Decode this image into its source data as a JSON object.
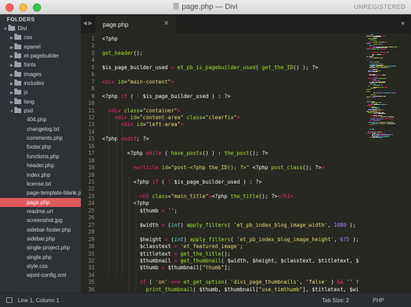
{
  "window": {
    "title": "page.php — Divi",
    "license": "UNREGISTERED"
  },
  "sidebar": {
    "header": "FOLDERS",
    "items": [
      {
        "label": "Divi",
        "type": "folder",
        "depth": 0,
        "open": true
      },
      {
        "label": "css",
        "type": "folder",
        "depth": 1,
        "open": false
      },
      {
        "label": "epanel",
        "type": "folder",
        "depth": 1,
        "open": false
      },
      {
        "label": "et-pagebuilder",
        "type": "folder",
        "depth": 1,
        "open": false
      },
      {
        "label": "fonts",
        "type": "folder",
        "depth": 1,
        "open": false
      },
      {
        "label": "images",
        "type": "folder",
        "depth": 1,
        "open": false
      },
      {
        "label": "includes",
        "type": "folder",
        "depth": 1,
        "open": false
      },
      {
        "label": "js",
        "type": "folder",
        "depth": 1,
        "open": false
      },
      {
        "label": "lang",
        "type": "folder",
        "depth": 1,
        "open": false
      },
      {
        "label": "psd",
        "type": "folder",
        "depth": 1,
        "open": true
      },
      {
        "label": "404.php",
        "type": "file",
        "depth": 2
      },
      {
        "label": "changelog.txt",
        "type": "file",
        "depth": 2
      },
      {
        "label": "comments.php",
        "type": "file",
        "depth": 2
      },
      {
        "label": "footer.php",
        "type": "file",
        "depth": 2
      },
      {
        "label": "functions.php",
        "type": "file",
        "depth": 2
      },
      {
        "label": "header.php",
        "type": "file",
        "depth": 2
      },
      {
        "label": "index.php",
        "type": "file",
        "depth": 2
      },
      {
        "label": "license.txt",
        "type": "file",
        "depth": 2
      },
      {
        "label": "page-template-blank.php",
        "type": "file",
        "depth": 2
      },
      {
        "label": "page.php",
        "type": "file",
        "depth": 2,
        "selected": true
      },
      {
        "label": "readme.url",
        "type": "file",
        "depth": 2
      },
      {
        "label": "screenshot.jpg",
        "type": "file",
        "depth": 2
      },
      {
        "label": "sidebar-footer.php",
        "type": "file",
        "depth": 2
      },
      {
        "label": "sidebar.php",
        "type": "file",
        "depth": 2
      },
      {
        "label": "single-project.php",
        "type": "file",
        "depth": 2
      },
      {
        "label": "single.php",
        "type": "file",
        "depth": 2
      },
      {
        "label": "style.css",
        "type": "file",
        "depth": 2
      },
      {
        "label": "wpml-config.xml",
        "type": "file",
        "depth": 2
      }
    ]
  },
  "tabbar": {
    "prev_icon": "◀",
    "next_icon": "▶",
    "active_tab": "page.php",
    "close_icon": "✕",
    "dropdown_icon": "▼"
  },
  "editor": {
    "lines": [
      {
        "n": "1",
        "segs": [
          [
            "php",
            "<?php"
          ]
        ]
      },
      {
        "n": "2",
        "segs": []
      },
      {
        "n": "3",
        "segs": [
          [
            "fn",
            "get_header"
          ],
          [
            "punc",
            "();"
          ]
        ]
      },
      {
        "n": "4",
        "segs": []
      },
      {
        "n": "5",
        "segs": [
          [
            "var",
            "$is_page_builder_used "
          ],
          [
            "kw",
            "="
          ],
          [
            "var",
            " "
          ],
          [
            "fn",
            "et_pb_is_pagebuilder_used"
          ],
          [
            "punc",
            "( "
          ],
          [
            "fn",
            "get_the_ID"
          ],
          [
            "punc",
            "() ); ?>"
          ]
        ]
      },
      {
        "n": "6",
        "segs": []
      },
      {
        "n": "7",
        "segs": [
          [
            "tag",
            "<div "
          ],
          [
            "attr",
            "id"
          ],
          [
            "punc",
            "="
          ],
          [
            "str",
            "\"main-content\""
          ],
          [
            "tag",
            ">"
          ]
        ]
      },
      {
        "n": "8",
        "segs": []
      },
      {
        "n": "9",
        "segs": [
          [
            "php",
            "<?php "
          ],
          [
            "kw",
            "if"
          ],
          [
            "punc",
            " ( "
          ],
          [
            "kw",
            "!"
          ],
          [
            "punc",
            " $is_page_builder_used ) : ?>"
          ]
        ]
      },
      {
        "n": "10",
        "segs": []
      },
      {
        "n": "11",
        "segs": [
          [
            "var",
            "  "
          ],
          [
            "tag",
            "<div "
          ],
          [
            "attr",
            "class"
          ],
          [
            "punc",
            "="
          ],
          [
            "str",
            "\"container\""
          ],
          [
            "tag",
            ">"
          ]
        ]
      },
      {
        "n": "12",
        "segs": [
          [
            "var",
            "    "
          ],
          [
            "tag",
            "<div "
          ],
          [
            "attr",
            "id"
          ],
          [
            "punc",
            "="
          ],
          [
            "str",
            "\"content-area\""
          ],
          [
            "var",
            " "
          ],
          [
            "attr",
            "class"
          ],
          [
            "punc",
            "="
          ],
          [
            "str",
            "\"clearfix\""
          ],
          [
            "tag",
            ">"
          ]
        ]
      },
      {
        "n": "13",
        "segs": [
          [
            "var",
            "      "
          ],
          [
            "tag",
            "<div "
          ],
          [
            "attr",
            "id"
          ],
          [
            "punc",
            "="
          ],
          [
            "str",
            "\"left-area\""
          ],
          [
            "tag",
            ">"
          ]
        ]
      },
      {
        "n": "14",
        "segs": []
      },
      {
        "n": "15",
        "segs": [
          [
            "php",
            "<?php "
          ],
          [
            "kw",
            "endif"
          ],
          [
            "punc",
            "; ?>"
          ]
        ]
      },
      {
        "n": "16",
        "segs": []
      },
      {
        "n": "17",
        "segs": [
          [
            "var",
            "        "
          ],
          [
            "php",
            "<?php "
          ],
          [
            "kw",
            "while"
          ],
          [
            "punc",
            " ( "
          ],
          [
            "fn",
            "have_posts"
          ],
          [
            "punc",
            "() ) : "
          ],
          [
            "fn",
            "the_post"
          ],
          [
            "punc",
            "(); ?>"
          ]
        ]
      },
      {
        "n": "18",
        "segs": []
      },
      {
        "n": "19",
        "segs": [
          [
            "var",
            "          "
          ],
          [
            "tag",
            "<article "
          ],
          [
            "attr",
            "id"
          ],
          [
            "punc",
            "="
          ],
          [
            "str",
            "\"post-<?php the_ID(); ?>\""
          ],
          [
            "var",
            " "
          ],
          [
            "php",
            "<?php "
          ],
          [
            "fn",
            "post_class"
          ],
          [
            "punc",
            "(); ?>"
          ],
          [
            "tag",
            ">"
          ]
        ]
      },
      {
        "n": "20",
        "segs": []
      },
      {
        "n": "21",
        "segs": [
          [
            "var",
            "          "
          ],
          [
            "php",
            "<?php "
          ],
          [
            "kw",
            "if"
          ],
          [
            "punc",
            " ( "
          ],
          [
            "kw",
            "!"
          ],
          [
            "punc",
            " $is_page_builder_used ) : ?>"
          ]
        ]
      },
      {
        "n": "22",
        "segs": []
      },
      {
        "n": "23",
        "segs": [
          [
            "var",
            "            "
          ],
          [
            "tag",
            "<h1 "
          ],
          [
            "attr",
            "class"
          ],
          [
            "punc",
            "="
          ],
          [
            "str",
            "\"main_title\""
          ],
          [
            "tag",
            ">"
          ],
          [
            "php",
            "<?php "
          ],
          [
            "fn",
            "the_title"
          ],
          [
            "punc",
            "(); ?>"
          ],
          [
            "tag",
            "</h1>"
          ]
        ]
      },
      {
        "n": "24",
        "segs": [
          [
            "var",
            "          "
          ],
          [
            "php",
            "<?php"
          ]
        ]
      },
      {
        "n": "25",
        "segs": [
          [
            "var",
            "            $thumb "
          ],
          [
            "kw",
            "="
          ],
          [
            "var",
            " "
          ],
          [
            "str",
            "''"
          ],
          [
            "punc",
            ";"
          ]
        ]
      },
      {
        "n": "26",
        "segs": []
      },
      {
        "n": "27",
        "segs": [
          [
            "var",
            "            $width "
          ],
          [
            "kw",
            "="
          ],
          [
            "var",
            " "
          ],
          [
            "punc",
            "("
          ],
          [
            "it",
            "int"
          ],
          [
            "punc",
            ") "
          ],
          [
            "fn",
            "apply_filters"
          ],
          [
            "punc",
            "( "
          ],
          [
            "str",
            "'et_pb_index_blog_image_width'"
          ],
          [
            "punc",
            ", "
          ],
          [
            "num",
            "1080"
          ],
          [
            "punc",
            " );"
          ]
        ]
      },
      {
        "n": "28",
        "segs": []
      },
      {
        "n": "29",
        "segs": [
          [
            "var",
            "            $height "
          ],
          [
            "kw",
            "="
          ],
          [
            "var",
            " "
          ],
          [
            "punc",
            "("
          ],
          [
            "it",
            "int"
          ],
          [
            "punc",
            ") "
          ],
          [
            "fn",
            "apply_filters"
          ],
          [
            "punc",
            "( "
          ],
          [
            "str",
            "'et_pb_index_blog_image_height'"
          ],
          [
            "punc",
            ", "
          ],
          [
            "num",
            "675"
          ],
          [
            "punc",
            " );"
          ]
        ]
      },
      {
        "n": "30",
        "segs": [
          [
            "var",
            "            $classtext "
          ],
          [
            "kw",
            "="
          ],
          [
            "var",
            " "
          ],
          [
            "str",
            "'et_featured_image'"
          ],
          [
            "punc",
            ";"
          ]
        ]
      },
      {
        "n": "31",
        "segs": [
          [
            "var",
            "            $titletext "
          ],
          [
            "kw",
            "="
          ],
          [
            "var",
            " "
          ],
          [
            "fn",
            "get_the_title"
          ],
          [
            "punc",
            "();"
          ]
        ]
      },
      {
        "n": "32",
        "segs": [
          [
            "var",
            "            $thumbnail "
          ],
          [
            "kw",
            "="
          ],
          [
            "var",
            " "
          ],
          [
            "fn",
            "get_thumbnail"
          ],
          [
            "punc",
            "( $width, $height, $classtext, $titletext, $"
          ]
        ]
      },
      {
        "n": "33",
        "segs": [
          [
            "var",
            "            $thumb "
          ],
          [
            "kw",
            "="
          ],
          [
            "var",
            " $thumbnail["
          ],
          [
            "str",
            "\"thumb\""
          ],
          [
            "punc",
            "];"
          ]
        ]
      },
      {
        "n": "34",
        "segs": []
      },
      {
        "n": "35",
        "segs": [
          [
            "var",
            "            "
          ],
          [
            "kw",
            "if"
          ],
          [
            "punc",
            " ( "
          ],
          [
            "str",
            "'on'"
          ],
          [
            "punc",
            " "
          ],
          [
            "kw",
            "==="
          ],
          [
            "punc",
            " "
          ],
          [
            "fn",
            "et_get_option"
          ],
          [
            "punc",
            "( "
          ],
          [
            "str",
            "'divi_page_thumbnails'"
          ],
          [
            "punc",
            ", "
          ],
          [
            "str",
            "'false'"
          ],
          [
            "punc",
            " ) "
          ],
          [
            "kw",
            "&&"
          ],
          [
            "punc",
            " "
          ],
          [
            "str",
            "''"
          ],
          [
            "punc",
            " !"
          ]
        ]
      },
      {
        "n": "36",
        "segs": [
          [
            "var",
            "              "
          ],
          [
            "fn",
            "print_thumbnail"
          ],
          [
            "punc",
            "( $thumb, $thumbnail["
          ],
          [
            "str",
            "\"use_timthumb\""
          ],
          [
            "punc",
            "], $titletext, $wi"
          ]
        ]
      }
    ]
  },
  "statusbar": {
    "position": "Line 1, Column 1",
    "tab_size": "Tab Size: 2",
    "syntax": "PHP"
  }
}
